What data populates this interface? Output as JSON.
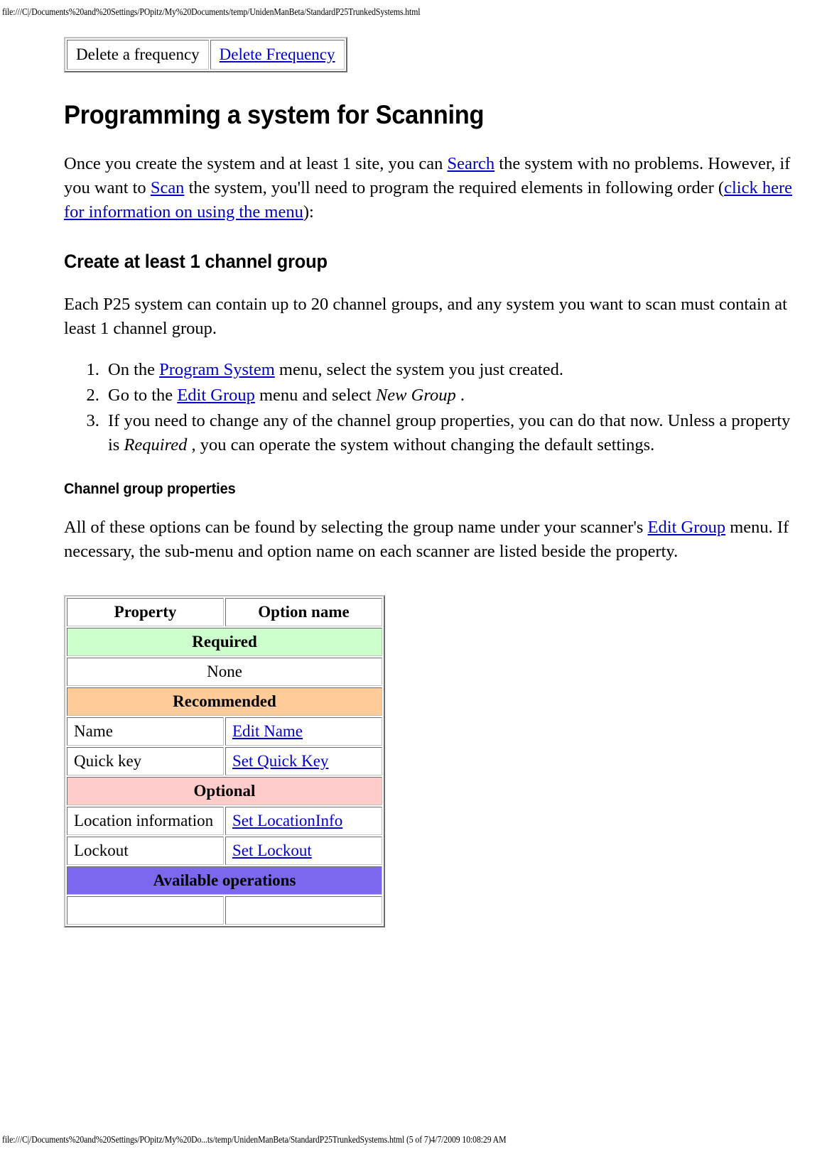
{
  "print_header": {
    "url": "file:///C|/Documents%20and%20Settings/POpitz/My%20Documents/temp/UnidenManBeta/StandardP25TrunkedSystems.html"
  },
  "print_footer": {
    "url": "file:///C|/Documents%20and%20Settings/POpitz/My%20Do...ts/temp/UnidenManBeta/StandardP25TrunkedSystems.html (5 of 7)4/7/2009 10:08:29 AM"
  },
  "delete_frequency_table": {
    "label": "Delete a frequency",
    "link": "Delete Frequency"
  },
  "headings": {
    "h1": "Programming a system for Scanning",
    "h2": "Create at least 1 channel group",
    "h3": "Channel group properties"
  },
  "intro_paragraph": {
    "part1": "Once you create the system and at least 1 site, you can ",
    "link1": "Search",
    "part2": " the system with no problems. However, if you want to ",
    "link2": "Scan",
    "part3": " the system, you'll need to program the required elements in following order (",
    "link3": "click here for information on using the menu",
    "part4": "):"
  },
  "group_paragraph": "Each P25 system can contain up to 20 channel groups, and any system you want to scan must contain at least 1 channel group.",
  "steps": [
    {
      "part1": "On the ",
      "link": "Program System",
      "part2": " menu, select the system you just created.",
      "emphasis": "",
      "part3": ""
    },
    {
      "part1": "Go to the ",
      "link": "Edit Group",
      "part2": " menu and select ",
      "emphasis": "New Group",
      "part3": " ."
    },
    {
      "part1": "If you need to change any of the channel group properties, you can do that now. Unless a property is ",
      "link": "",
      "part2": "",
      "emphasis": "Required",
      "part3": " , you can operate the system without changing the default settings."
    }
  ],
  "properties_paragraph": {
    "part1": "All of these options can be found by selecting the group name under your scanner's ",
    "link": "Edit Group",
    "part2": " menu. If necessary, the sub-menu and option name on each scanner are listed beside the property."
  },
  "properties_table": {
    "headers": [
      "Property",
      "Option name"
    ],
    "rows": [
      {
        "type": "category",
        "label": "Required",
        "color": "#ccffcc"
      },
      {
        "type": "single",
        "label": "None"
      },
      {
        "type": "category",
        "label": "Recommended",
        "color": "#ffcc99"
      },
      {
        "type": "pair",
        "property": "Name",
        "option": "Edit Name"
      },
      {
        "type": "pair",
        "property": "Quick key",
        "option": "Set Quick Key"
      },
      {
        "type": "category",
        "label": "Optional",
        "color": "#ffcccc"
      },
      {
        "type": "pair",
        "property": "Location information",
        "option": "Set LocationInfo"
      },
      {
        "type": "pair",
        "property": "Lockout",
        "option": "Set Lockout"
      },
      {
        "type": "category",
        "label": "Available operations",
        "color": "#7b68ee"
      }
    ]
  }
}
